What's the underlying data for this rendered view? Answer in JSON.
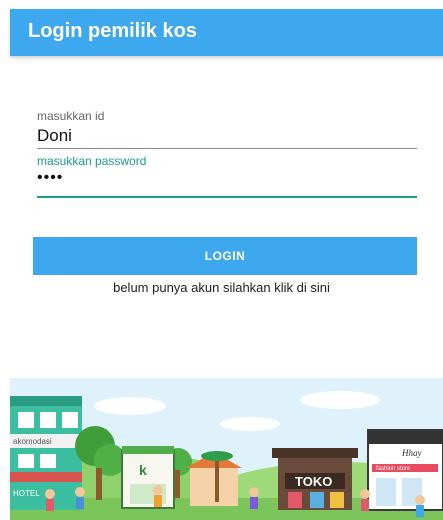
{
  "appbar": {
    "title": "Login pemilik kos"
  },
  "form": {
    "id_label": "masukkan id",
    "id_value": "Doni",
    "password_label": "masukkan password",
    "password_value": "••••"
  },
  "login_button": {
    "label": "LOGIN"
  },
  "register_link": {
    "text": "belum punya akun silahkan klik di sini"
  },
  "illustration": {
    "sign_akomodasi": "akomodasi",
    "sign_hotel": "HOTEL",
    "sign_toko": "TOKO",
    "sign_store": "Hhay",
    "sign_store_sub": "fashion store"
  },
  "colors": {
    "primary": "#3ea8ee",
    "accent": "#1a9e8c"
  }
}
